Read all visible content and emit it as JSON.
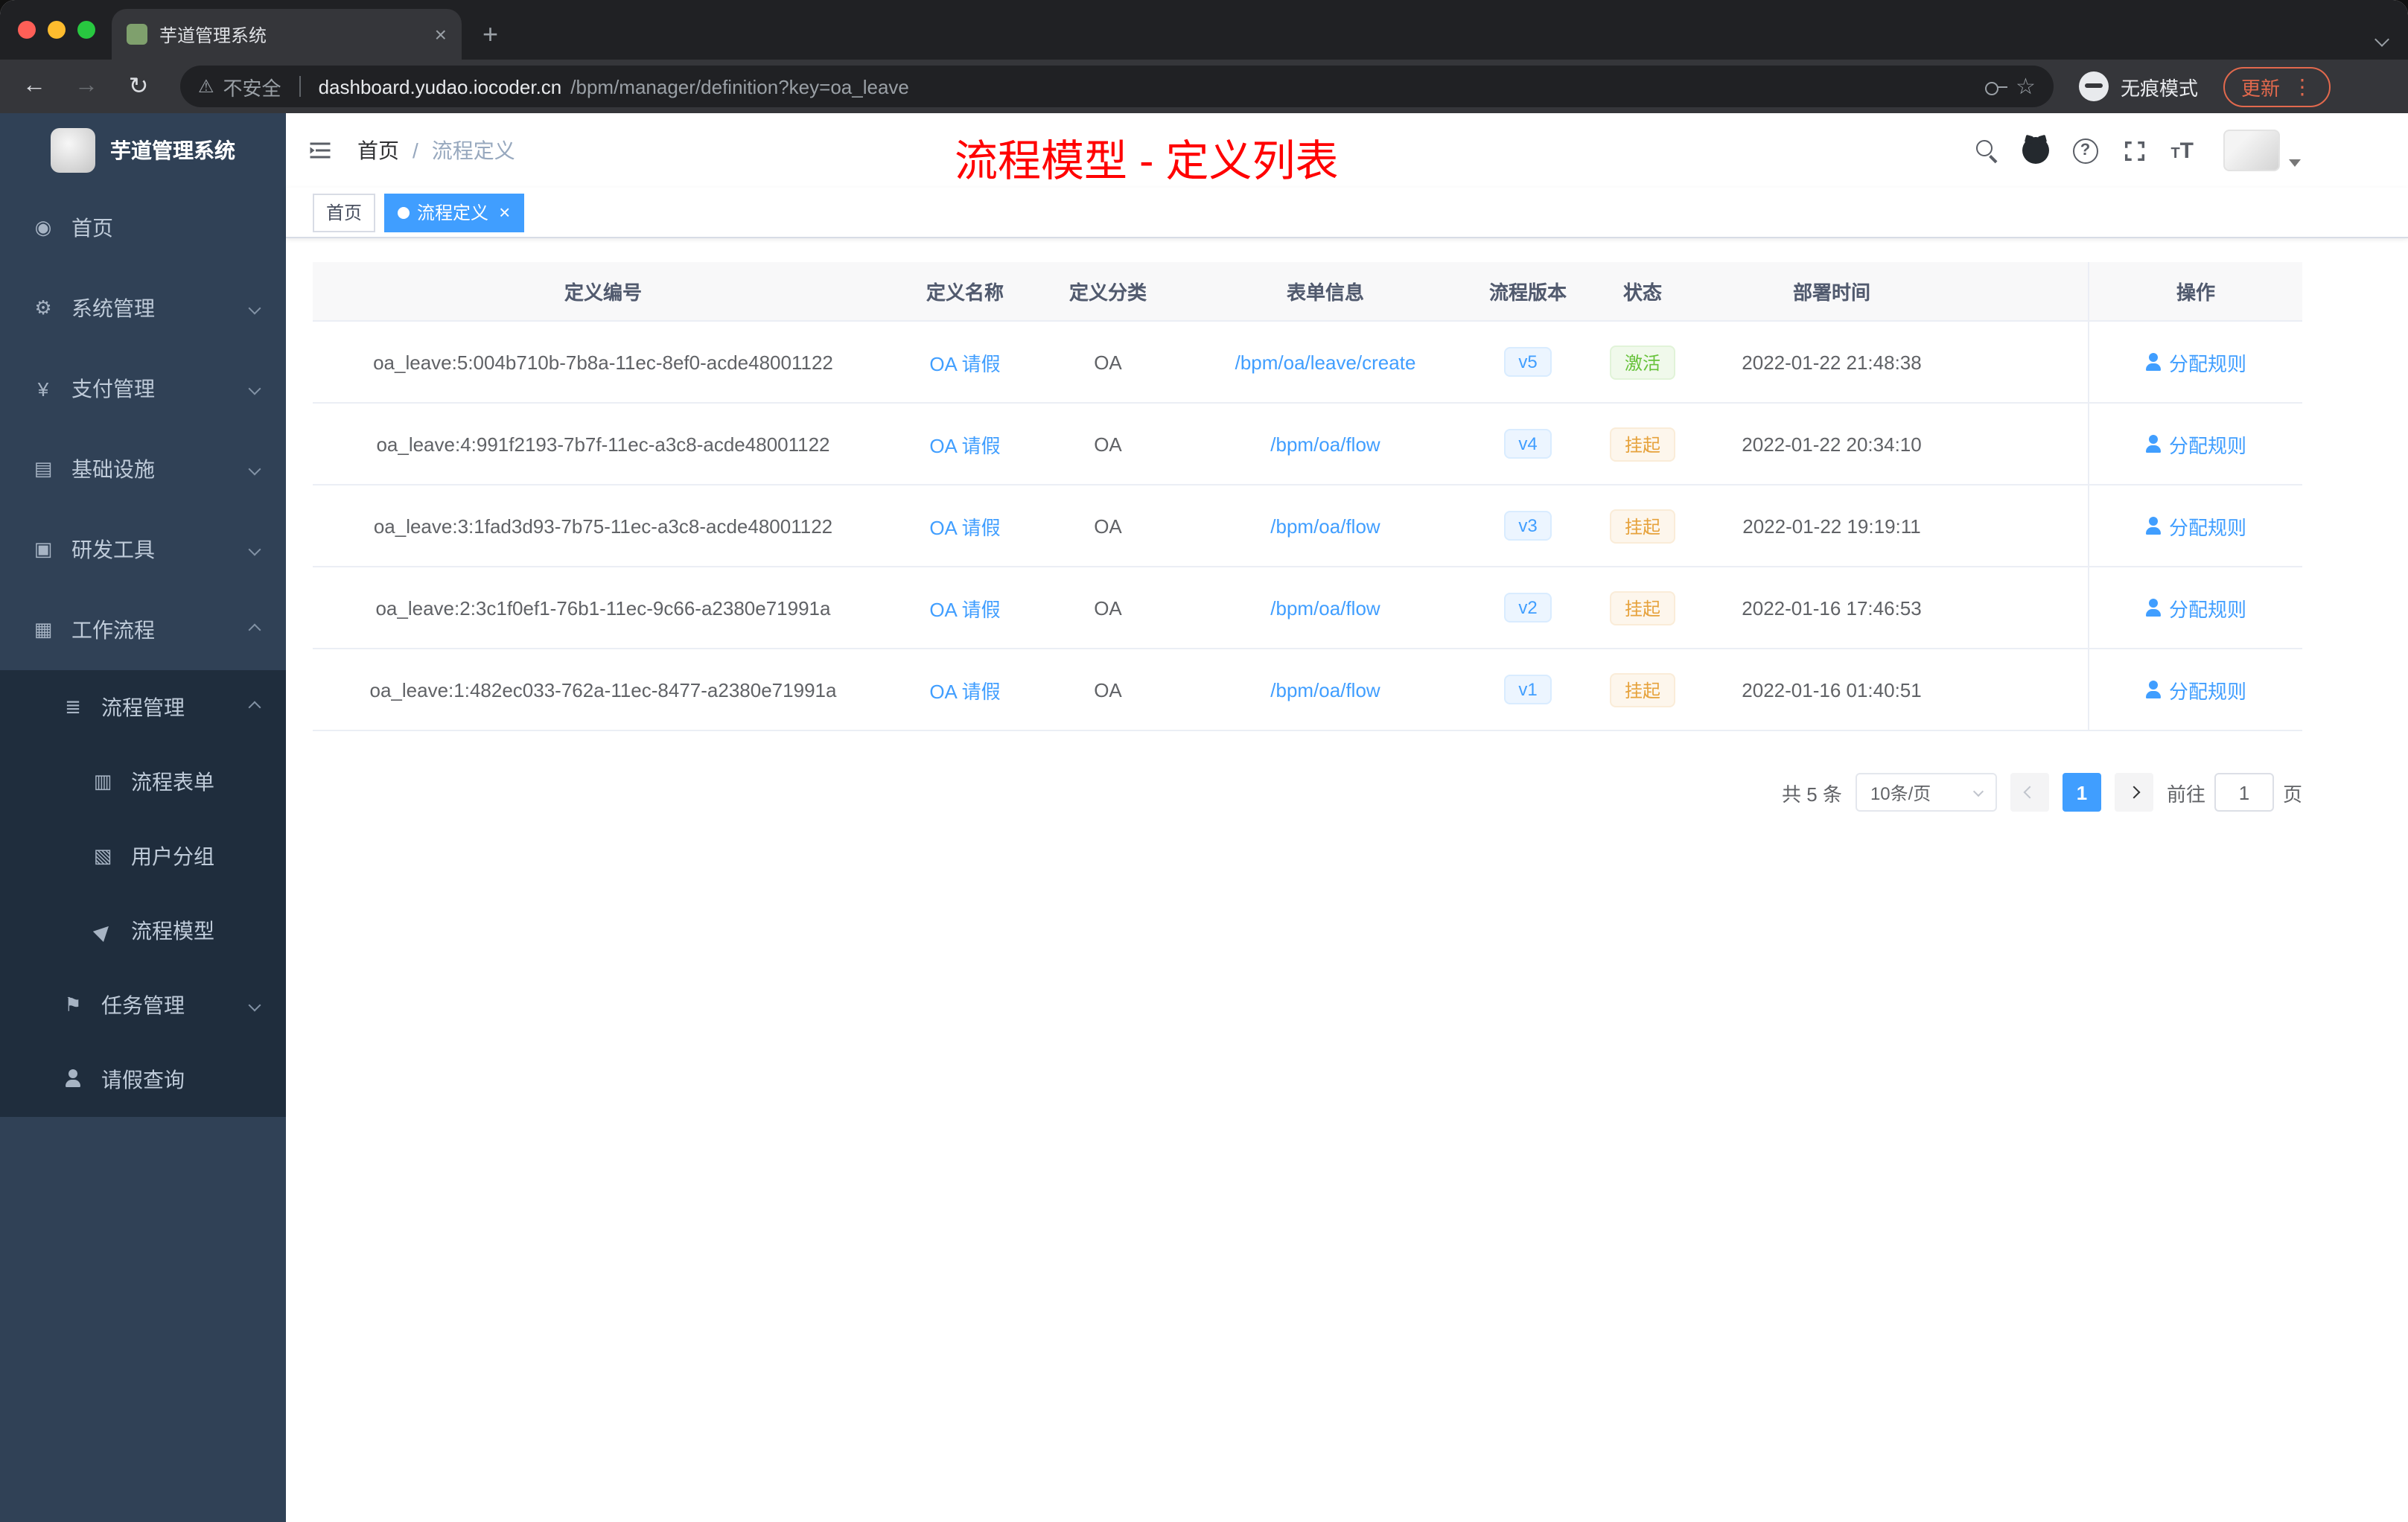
{
  "browser": {
    "tab_title": "芋道管理系统",
    "security_label": "不安全",
    "url_domain": "dashboard.yudao.iocoder.cn",
    "url_path": "/bpm/manager/definition?key=oa_leave",
    "incognito_label": "无痕模式",
    "update_label": "更新"
  },
  "icons": {
    "back": "←",
    "forward": "→",
    "reload": "↻",
    "warning": "⚠",
    "star": "☆",
    "dots": "⋮",
    "close": "×",
    "plus": "+",
    "question": "?",
    "dashboard": "◉",
    "system": "⚙",
    "pay": "¥",
    "infra": "▤",
    "tools": "▣",
    "workflow": "▦",
    "pmgmt": "≣",
    "form": "▥",
    "group": "▧",
    "model": "▶",
    "task": "⚑",
    "font_small": "T",
    "font_large": "T"
  },
  "sidebar": {
    "logo_title": "芋道管理系统",
    "items": [
      {
        "label": "首页"
      },
      {
        "label": "系统管理"
      },
      {
        "label": "支付管理"
      },
      {
        "label": "基础设施"
      },
      {
        "label": "研发工具"
      },
      {
        "label": "工作流程"
      },
      {
        "label": "流程管理"
      },
      {
        "label": "流程表单"
      },
      {
        "label": "用户分组"
      },
      {
        "label": "流程模型"
      },
      {
        "label": "任务管理"
      },
      {
        "label": "请假查询"
      }
    ]
  },
  "topbar": {
    "breadcrumb_home": "首页",
    "breadcrumb_separator": "/",
    "breadcrumb_current": "流程定义",
    "annotation": "流程模型 - 定义列表"
  },
  "tags": [
    {
      "label": "首页",
      "active": false
    },
    {
      "label": "流程定义",
      "active": true
    }
  ],
  "table": {
    "columns": [
      "定义编号",
      "定义名称",
      "定义分类",
      "表单信息",
      "流程版本",
      "状态",
      "部署时间",
      "操作"
    ],
    "rows": [
      {
        "id": "oa_leave:5:004b710b-7b8a-11ec-8ef0-acde48001122",
        "name": "OA 请假",
        "category": "OA",
        "form": "/bpm/oa/leave/create",
        "version": "v5",
        "status": "激活",
        "status_type": "success",
        "deploy_time": "2022-01-22 21:48:38",
        "action": "分配规则"
      },
      {
        "id": "oa_leave:4:991f2193-7b7f-11ec-a3c8-acde48001122",
        "name": "OA 请假",
        "category": "OA",
        "form": "/bpm/oa/flow",
        "version": "v4",
        "status": "挂起",
        "status_type": "warning",
        "deploy_time": "2022-01-22 20:34:10",
        "action": "分配规则"
      },
      {
        "id": "oa_leave:3:1fad3d93-7b75-11ec-a3c8-acde48001122",
        "name": "OA 请假",
        "category": "OA",
        "form": "/bpm/oa/flow",
        "version": "v3",
        "status": "挂起",
        "status_type": "warning",
        "deploy_time": "2022-01-22 19:19:11",
        "action": "分配规则"
      },
      {
        "id": "oa_leave:2:3c1f0ef1-76b1-11ec-9c66-a2380e71991a",
        "name": "OA 请假",
        "category": "OA",
        "form": "/bpm/oa/flow",
        "version": "v2",
        "status": "挂起",
        "status_type": "warning",
        "deploy_time": "2022-01-16 17:46:53",
        "action": "分配规则"
      },
      {
        "id": "oa_leave:1:482ec033-762a-11ec-8477-a2380e71991a",
        "name": "OA 请假",
        "category": "OA",
        "form": "/bpm/oa/flow",
        "version": "v1",
        "status": "挂起",
        "status_type": "warning",
        "deploy_time": "2022-01-16 01:40:51",
        "action": "分配规则"
      }
    ]
  },
  "pagination": {
    "total_label": "共 5 条",
    "page_size": "10条/页",
    "current_page": "1",
    "goto_label": "前往",
    "goto_value": "1",
    "goto_suffix": "页"
  },
  "colors": {
    "primary": "#409EFF",
    "success": "#67C23A",
    "warning": "#E6A23C",
    "annotation_red": "#FF0000",
    "sidebar_bg": "#304156",
    "submenu_bg": "#1F2D3D"
  }
}
